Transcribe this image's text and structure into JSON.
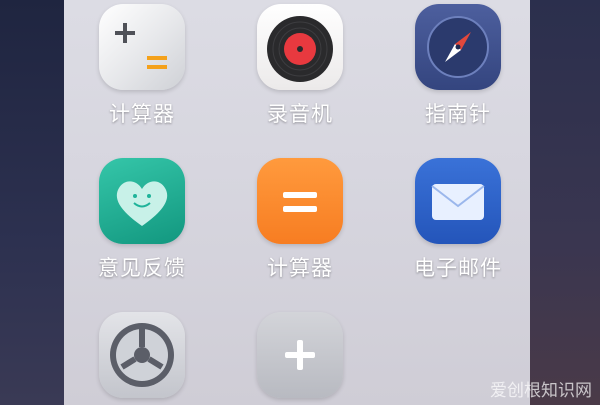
{
  "apps": [
    {
      "label": "计算器",
      "icon": "calculator-silver-icon"
    },
    {
      "label": "录音机",
      "icon": "recorder-icon"
    },
    {
      "label": "指南针",
      "icon": "compass-icon"
    },
    {
      "label": "意见反馈",
      "icon": "feedback-heart-icon"
    },
    {
      "label": "计算器",
      "icon": "calculator-orange-icon"
    },
    {
      "label": "电子邮件",
      "icon": "email-icon"
    },
    {
      "label": "",
      "icon": "settings-gear-icon"
    },
    {
      "label": "",
      "icon": "add-icon"
    }
  ],
  "watermark": "爱创根知识网",
  "colors": {
    "calculator_orange": "#fb8a2f",
    "compass_blue": "#3c4f8e",
    "feedback_green": "#1fb39a",
    "email_blue": "#2e63c9",
    "recorder_red": "#e8393f"
  }
}
